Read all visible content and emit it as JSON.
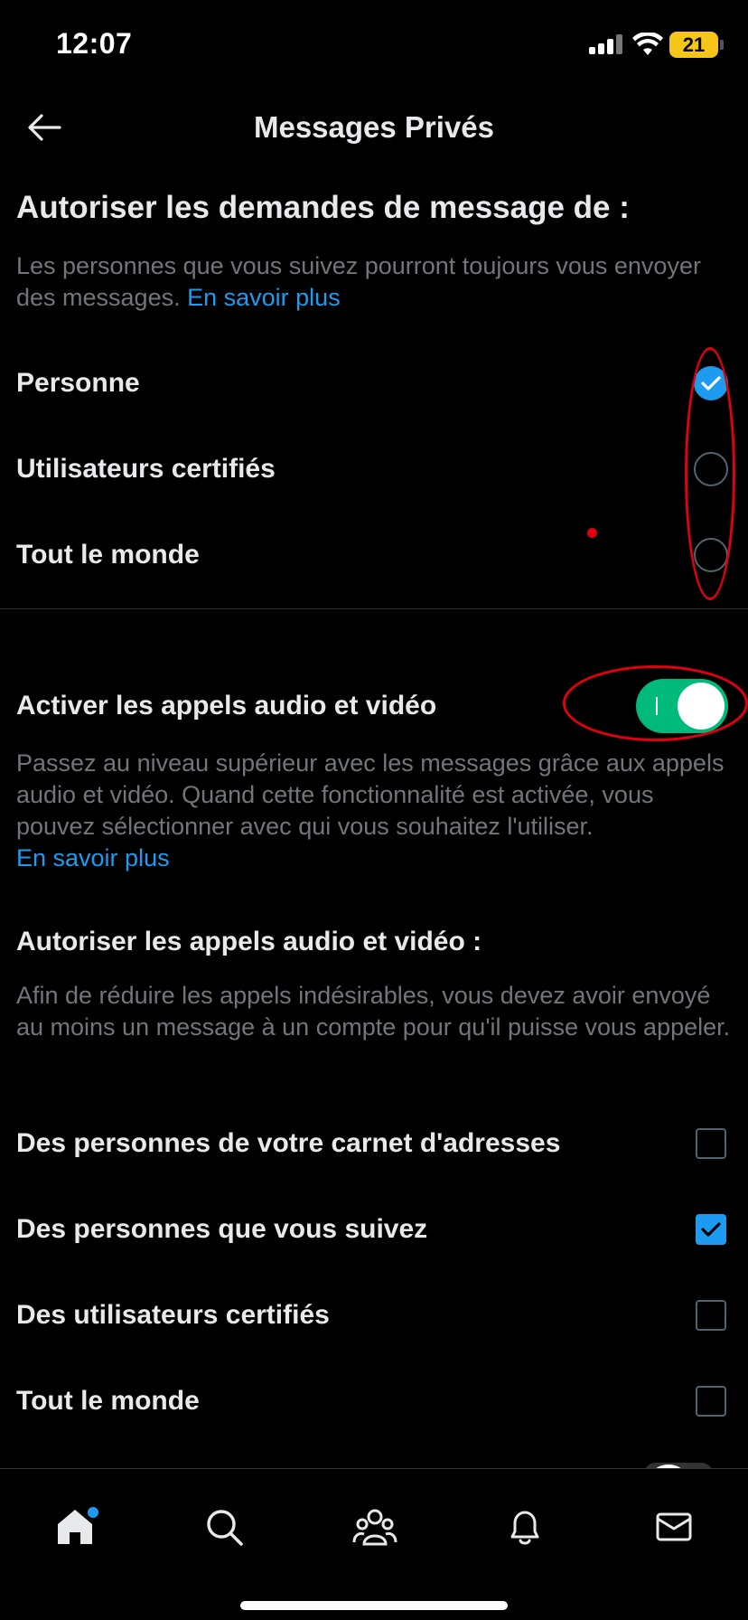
{
  "status_bar": {
    "time": "12:07",
    "battery": "21"
  },
  "header": {
    "title": "Messages Privés"
  },
  "message_requests": {
    "heading": "Autoriser les demandes de message de :",
    "description": "Les personnes que vous suivez pourront toujours vous envoyer des messages.",
    "learn_more": "En savoir plus",
    "options": [
      {
        "label": "Personne",
        "selected": true
      },
      {
        "label": "Utilisateurs certifiés",
        "selected": false
      },
      {
        "label": "Tout le monde",
        "selected": false
      }
    ]
  },
  "calls": {
    "toggle_label": "Activer les appels audio et vidéo",
    "toggle_on": true,
    "description": "Passez au niveau supérieur avec les messages grâce aux appels audio et vidéo. Quand cette fonctionnalité est activée, vous pouvez sélectionner avec qui vous souhaitez l'utiliser.",
    "learn_more": "En savoir plus",
    "allow_heading": "Autoriser les appels audio et vidéo :",
    "allow_description": "Afin de réduire les appels indésirables, vous devez avoir envoyé au moins un message à un compte pour qu'il puisse vous appeler.",
    "options": [
      {
        "label": "Des personnes de votre carnet d'adresses",
        "checked": false
      },
      {
        "label": "Des personnes que vous suivez",
        "checked": true
      },
      {
        "label": "Des utilisateurs certifiés",
        "checked": false
      },
      {
        "label": "Tout le monde",
        "checked": false
      }
    ]
  },
  "bottom_nav": {
    "items": [
      "home-icon",
      "search-icon",
      "communities-icon",
      "notifications-icon",
      "messages-icon"
    ],
    "home_has_badge": true
  },
  "colors": {
    "accent": "#1d9bf0",
    "toggle_on": "#00ba7c",
    "annotation": "#e0000f",
    "secondary_text": "#71767b",
    "battery": "#f5c518"
  }
}
